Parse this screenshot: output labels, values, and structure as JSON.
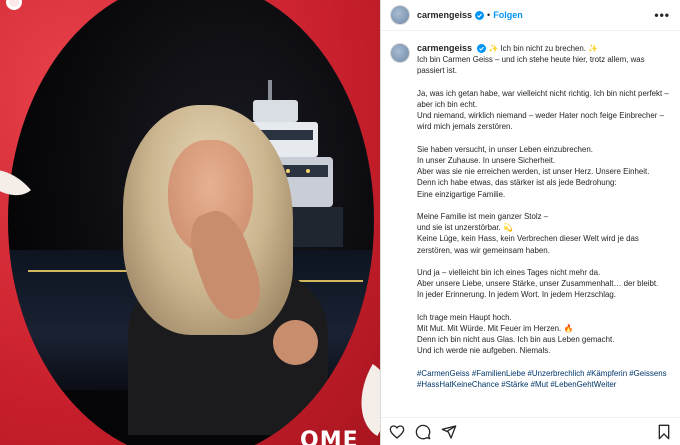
{
  "header": {
    "username": "carmengeiss",
    "separator": "•",
    "follow_label": "Folgen",
    "more_label": "•••"
  },
  "caption": {
    "username": "carmengeiss",
    "first_line": "✨ Ich bin nicht zu brechen. ✨",
    "paragraphs": [
      [
        "Ich bin Carmen Geiss – und ich stehe heute hier, trotz allem, was passiert ist."
      ],
      [
        "Ja, was ich getan habe, war vielleicht nicht richtig. Ich bin nicht perfekt – aber ich bin echt.",
        "Und niemand, wirklich niemand – weder Hater noch feige Einbrecher – wird mich jemals zerstören."
      ],
      [
        "Sie haben versucht, in unser Leben einzubrechen.",
        "In unser Zuhause. In unsere Sicherheit.",
        "Aber was sie nie erreichen werden, ist unser Herz. Unsere Einheit.",
        "Denn ich habe etwas, das stärker ist als jede Bedrohung:",
        "Eine einzigartige Familie."
      ],
      [
        "Meine Familie ist mein ganzer Stolz –",
        "und sie ist unzerstörbar. 💫",
        "Keine Lüge, kein Hass, kein Verbrechen dieser Welt wird je das zerstören, was wir gemeinsam haben."
      ],
      [
        "Und ja – vielleicht bin ich eines Tages nicht mehr da.",
        "Aber unsere Liebe, unsere Stärke, unser Zusammenhalt… der bleibt.",
        "In jeder Erinnerung. In jedem Wort. In jedem Herzschlag."
      ],
      [
        "Ich trage mein Haupt hoch.",
        "Mit Mut. Mit Würde. Mit Feuer im Herzen. 🔥",
        "Denn ich bin nicht aus Glas. Ich bin aus Leben gemacht.",
        "Und ich werde nie aufgeben. Niemals."
      ]
    ],
    "hashtags": "#CarmenGeiss #FamilienLiebe #Unzerbrechlich #Kämpferin #Geissens #HassHatKeineChance #Stärke #Mut #LebenGehtWeiter"
  },
  "image": {
    "frame_text": "OME"
  },
  "colors": {
    "accent": "#0095f6",
    "frame_red": "#d42a35",
    "hashtag": "#00376b"
  },
  "icons": {
    "like": "heart-icon",
    "comment": "comment-icon",
    "share": "share-icon",
    "save": "bookmark-icon",
    "verified": "verified-badge-icon"
  }
}
